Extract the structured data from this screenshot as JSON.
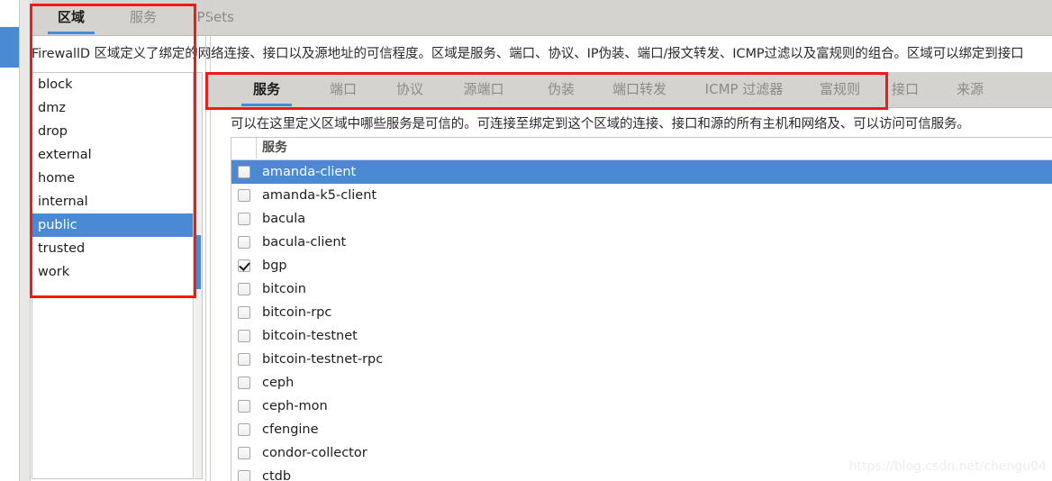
{
  "window": {
    "watermark": "https://blog.csdn.net/chengu04"
  },
  "top_tabs": [
    {
      "label": "区域",
      "active": true
    },
    {
      "label": "服务",
      "active": false
    },
    {
      "label": "IPSets",
      "active": false
    }
  ],
  "zone_description": "FirewallD 区域定义了绑定的网络连接、接口以及源地址的可信程度。区域是服务、端口、协议、IP伪装、端口/报文转发、ICMP过滤以及富规则的组合。区域可以绑定到接口",
  "zone_list": {
    "items": [
      {
        "label": "block",
        "selected": false
      },
      {
        "label": "dmz",
        "selected": false
      },
      {
        "label": "drop",
        "selected": false
      },
      {
        "label": "external",
        "selected": false
      },
      {
        "label": "home",
        "selected": false
      },
      {
        "label": "internal",
        "selected": false
      },
      {
        "label": "public",
        "selected": true
      },
      {
        "label": "trusted",
        "selected": false
      },
      {
        "label": "work",
        "selected": false
      }
    ]
  },
  "inner_tabs": [
    {
      "label": "服务",
      "active": true
    },
    {
      "label": "端口",
      "active": false
    },
    {
      "label": "协议",
      "active": false
    },
    {
      "label": "源端口",
      "active": false
    },
    {
      "label": "伪装",
      "active": false
    },
    {
      "label": "端口转发",
      "active": false
    },
    {
      "label": "ICMP 过滤器",
      "active": false
    },
    {
      "label": "富规则",
      "active": false
    },
    {
      "label": "接口",
      "active": false
    },
    {
      "label": "来源",
      "active": false
    }
  ],
  "service_description": "可以在这里定义区域中哪些服务是可信的。可连接至绑定到这个区域的连接、接口和源的所有主机和网络及、可以访问可信服务。",
  "service_table": {
    "header": "服务",
    "rows": [
      {
        "label": "amanda-client",
        "checked": false,
        "selected": true
      },
      {
        "label": "amanda-k5-client",
        "checked": false,
        "selected": false
      },
      {
        "label": "bacula",
        "checked": false,
        "selected": false
      },
      {
        "label": "bacula-client",
        "checked": false,
        "selected": false
      },
      {
        "label": "bgp",
        "checked": true,
        "selected": false
      },
      {
        "label": "bitcoin",
        "checked": false,
        "selected": false
      },
      {
        "label": "bitcoin-rpc",
        "checked": false,
        "selected": false
      },
      {
        "label": "bitcoin-testnet",
        "checked": false,
        "selected": false
      },
      {
        "label": "bitcoin-testnet-rpc",
        "checked": false,
        "selected": false
      },
      {
        "label": "ceph",
        "checked": false,
        "selected": false
      },
      {
        "label": "ceph-mon",
        "checked": false,
        "selected": false
      },
      {
        "label": "cfengine",
        "checked": false,
        "selected": false
      },
      {
        "label": "condor-collector",
        "checked": false,
        "selected": false
      },
      {
        "label": "ctdb",
        "checked": false,
        "selected": false
      }
    ]
  },
  "colors": {
    "accent": "#4a8ad4",
    "annotation": "#ee1b1b",
    "tabbar": "#d4d3d0"
  }
}
